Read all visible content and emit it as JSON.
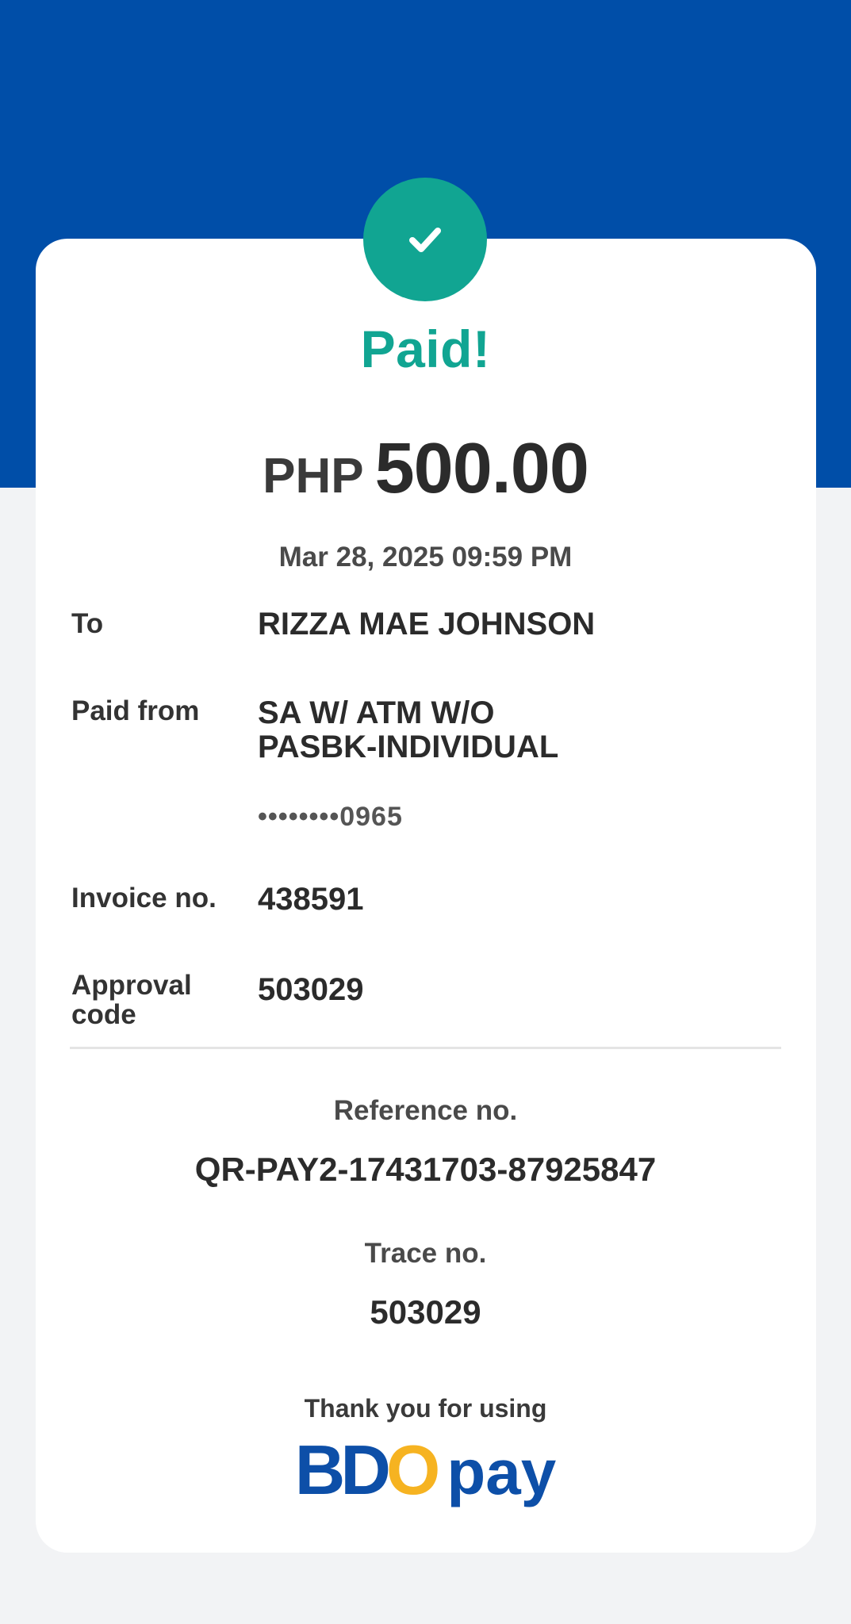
{
  "status": {
    "title": "Paid!",
    "icon": "check-icon",
    "color": "#11a592"
  },
  "payment": {
    "currency": "PHP",
    "amount": "500.00",
    "datetime": "Mar 28, 2025 09:59 PM"
  },
  "details": {
    "to": {
      "label": "To",
      "value": "RIZZA MAE JOHNSON"
    },
    "paid_from": {
      "label": "Paid from",
      "value_line1": "SA W/ ATM W/O",
      "value_line2": "PASBK-INDIVIDUAL",
      "account_masked": "••••••••0965"
    },
    "invoice": {
      "label": "Invoice no.",
      "value": "438591"
    },
    "approval": {
      "label_line1": "Approval",
      "label_line2": "code",
      "value": "503029"
    }
  },
  "reference": {
    "label": "Reference no.",
    "value": "QR-PAY2-17431703-87925847"
  },
  "trace": {
    "label": "Trace no.",
    "value": "503029"
  },
  "footer": {
    "thanks": "Thank you for using",
    "logo": {
      "b": "B",
      "d": "D",
      "o": "O",
      "pay": "pay"
    }
  },
  "colors": {
    "header_blue": "#004ea8",
    "success_green": "#11a592",
    "brand_blue": "#0d4fa8",
    "brand_yellow": "#f6b321"
  }
}
